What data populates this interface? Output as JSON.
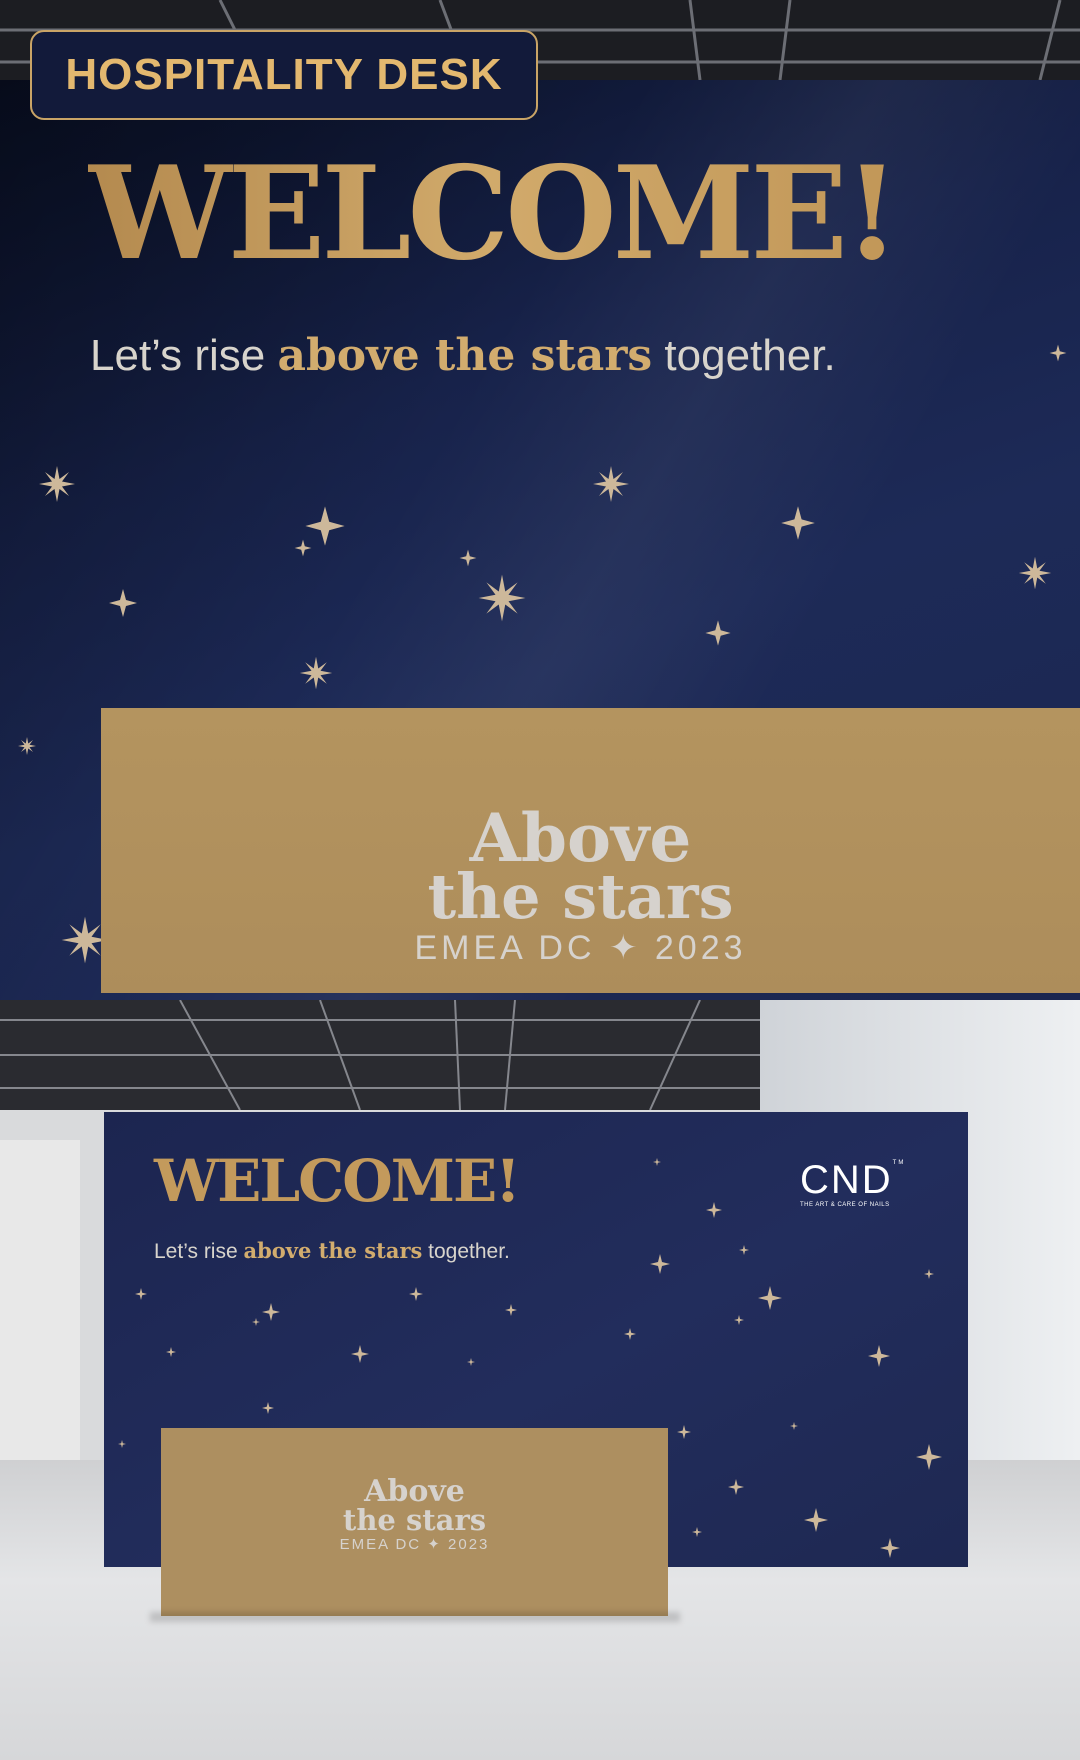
{
  "badge": {
    "label": "HOSPITALITY DESK"
  },
  "sign": {
    "headline": "WELCOME!",
    "tagline_pre": "Let’s rise ",
    "tagline_bold": "above the stars",
    "tagline_post": " together."
  },
  "desk_logo": {
    "line1": "Above",
    "line2": "the stars",
    "line3": "EMEA DC ✦ 2023"
  },
  "brand": {
    "mark": "CND",
    "tm": "TM",
    "subline": "THE ART & CARE OF NAILS"
  },
  "colors": {
    "navy": "#1d2a57",
    "gold": "#c39a5c",
    "desk": "#b0915f",
    "logo_grey": "#d6d2cd"
  }
}
